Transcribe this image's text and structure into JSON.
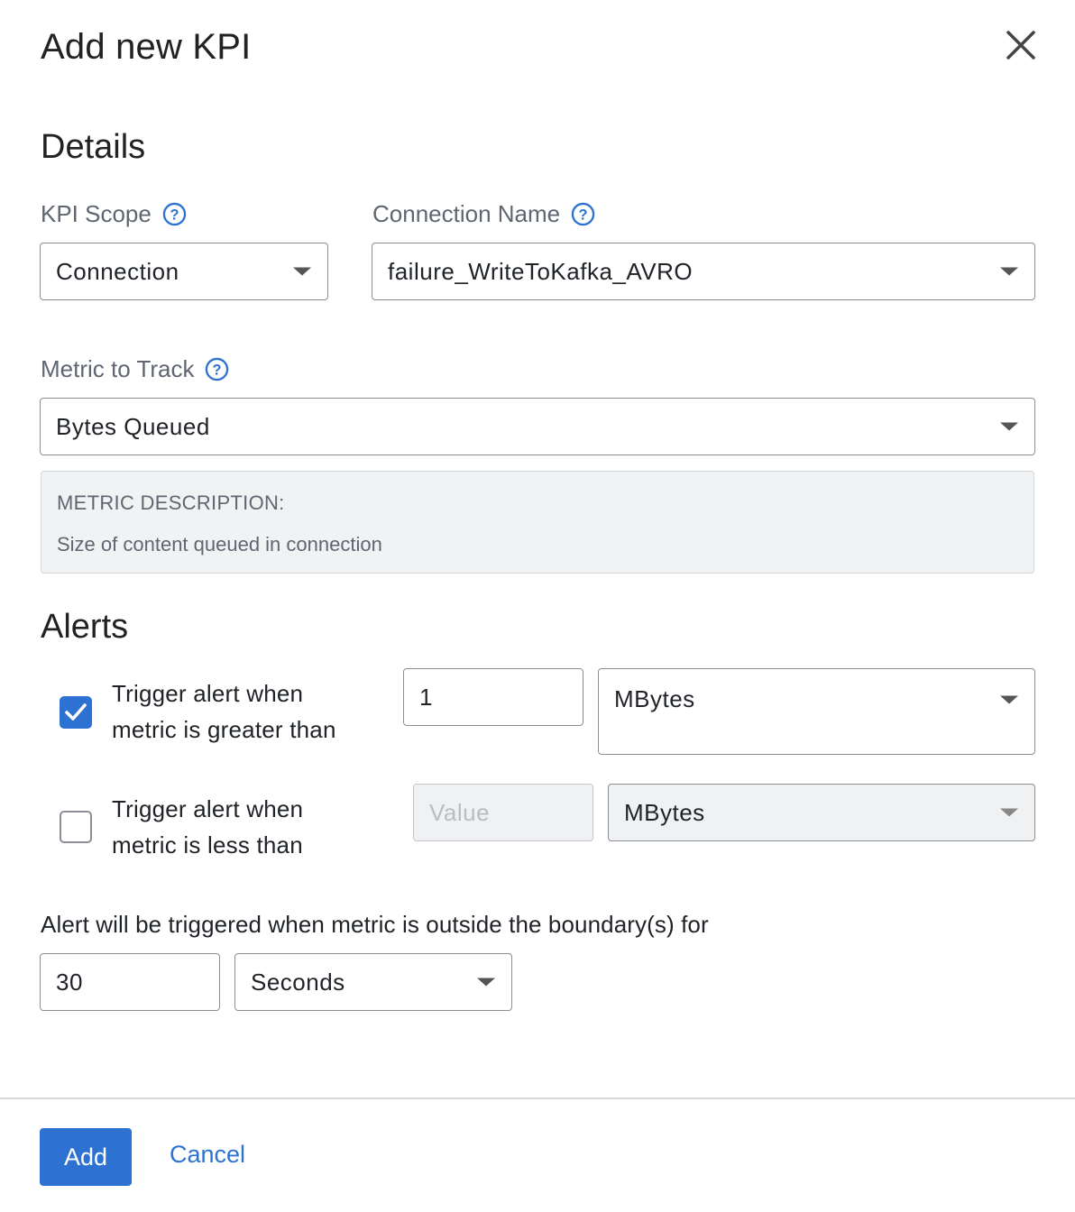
{
  "dialog": {
    "title": "Add new KPI",
    "close_label": "close"
  },
  "details": {
    "heading": "Details",
    "kpi_scope": {
      "label": "KPI Scope",
      "value": "Connection"
    },
    "connection_name": {
      "label": "Connection Name",
      "value": "failure_WriteToKafka_AVRO"
    },
    "metric": {
      "label": "Metric to Track",
      "value": "Bytes Queued"
    },
    "description": {
      "heading": "METRIC DESCRIPTION:",
      "text": "Size of content queued in connection"
    }
  },
  "alerts": {
    "heading": "Alerts",
    "greater": {
      "checked": true,
      "line1": "Trigger alert when",
      "line2": "metric is greater than",
      "value": "1",
      "unit": "MBytes"
    },
    "less": {
      "checked": false,
      "line1": "Trigger alert when",
      "line2": "metric is less than",
      "placeholder": "Value",
      "unit": "MBytes"
    },
    "boundary_text": "Alert will be triggered when metric is outside the boundary(s) for",
    "duration_value": "30",
    "duration_unit": "Seconds"
  },
  "footer": {
    "add_label": "Add",
    "cancel_label": "Cancel"
  },
  "colors": {
    "accent": "#2d72d2",
    "muted_text": "#5f6670",
    "disabled_bg": "#f0f1f3"
  },
  "icons": {
    "close": "close-icon",
    "help": "help-circle-icon",
    "caret": "caret-down-icon",
    "check": "checkmark-icon"
  }
}
